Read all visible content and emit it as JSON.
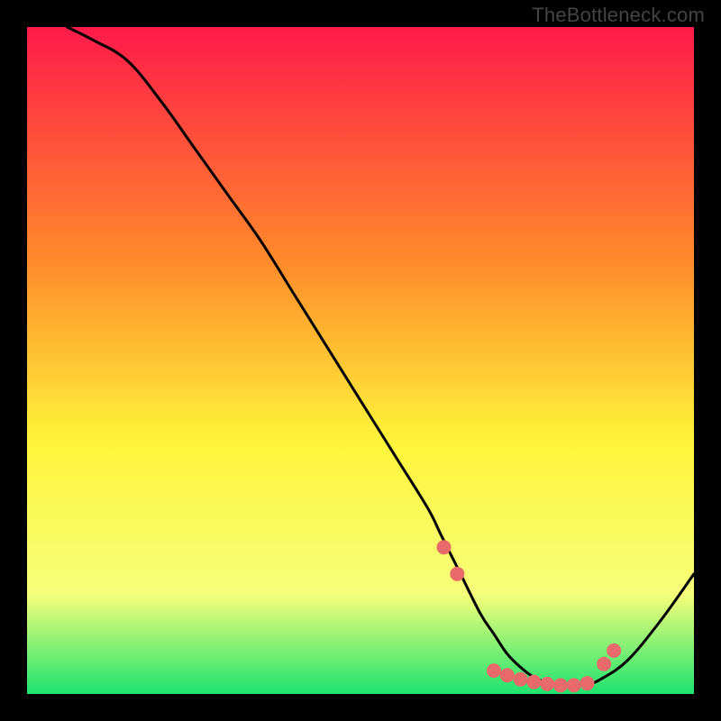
{
  "watermark": "TheBottleneck.com",
  "chart_data": {
    "type": "line",
    "title": "",
    "xlabel": "",
    "ylabel": "",
    "xlim": [
      0,
      100
    ],
    "ylim": [
      0,
      100
    ],
    "grid": false,
    "background_gradient": {
      "top": "#ff1a4a",
      "mid1": "#ff8a2a",
      "mid2": "#fff43a",
      "low": "#f6ff7a",
      "bottom": "#1de36f"
    },
    "series": [
      {
        "name": "bottleneck-curve",
        "x": [
          6,
          10,
          15,
          20,
          25,
          30,
          35,
          40,
          45,
          50,
          55,
          60,
          62,
          65,
          68,
          70,
          72,
          74,
          76,
          78,
          80,
          82,
          84,
          86,
          90,
          95,
          100
        ],
        "y": [
          100,
          98,
          95,
          89,
          82,
          75,
          68,
          60,
          52,
          44,
          36,
          28,
          24,
          18,
          12,
          9,
          6,
          4,
          2.5,
          1.7,
          1.3,
          1.2,
          1.4,
          2.2,
          5,
          11,
          18
        ],
        "color": "#000000"
      }
    ],
    "markers": {
      "name": "highlight-dots",
      "color": "#e86a6a",
      "points_x": [
        62.5,
        64.5,
        70,
        72,
        74,
        76,
        78,
        80,
        82,
        84,
        86.5,
        88
      ],
      "points_y": [
        22,
        18,
        3.5,
        2.8,
        2.2,
        1.8,
        1.5,
        1.3,
        1.3,
        1.6,
        4.5,
        6.5
      ]
    }
  }
}
